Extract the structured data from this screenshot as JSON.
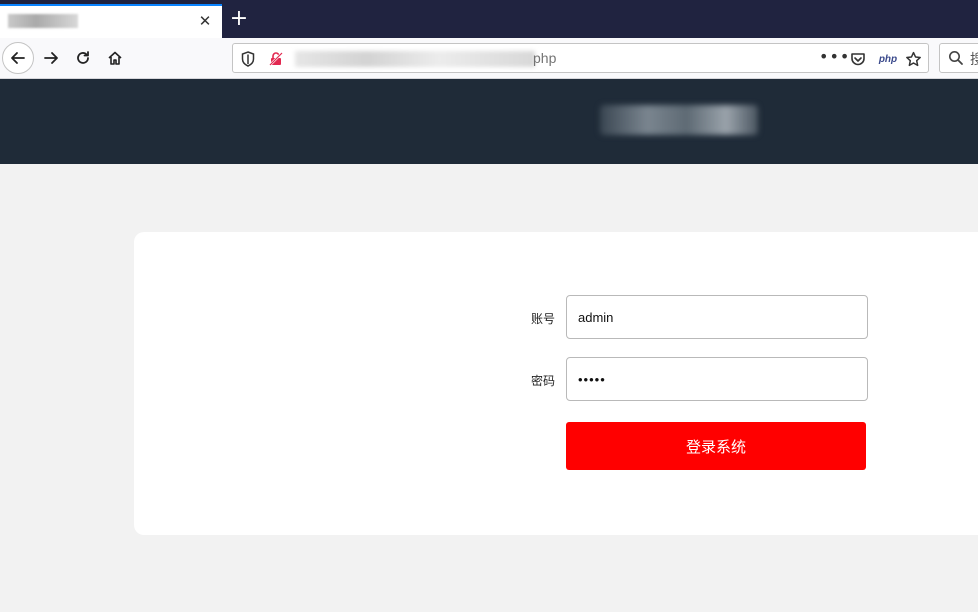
{
  "browser": {
    "tab": {
      "title": "",
      "close_glyph": "✕"
    },
    "new_tab_glyph": "+",
    "nav": {
      "back_icon": "arrow-left-icon",
      "forward_icon": "arrow-right-icon",
      "reload_icon": "reload-icon",
      "home_icon": "home-icon"
    },
    "url": {
      "visible_text": "php",
      "more_glyph": "•••",
      "php_badge": "php"
    },
    "search": {
      "placeholder": "搜"
    }
  },
  "page": {
    "header": {
      "logo_text": ""
    },
    "login": {
      "username_label": "账号",
      "username_value": "admin",
      "password_label": "密码",
      "password_mask": "•••••",
      "submit_label": "登录系统"
    }
  },
  "colors": {
    "tab_strip": "#202340",
    "header_bg": "#1f2b38",
    "page_bg": "#f2f2f2",
    "button_bg": "#ff0000"
  }
}
